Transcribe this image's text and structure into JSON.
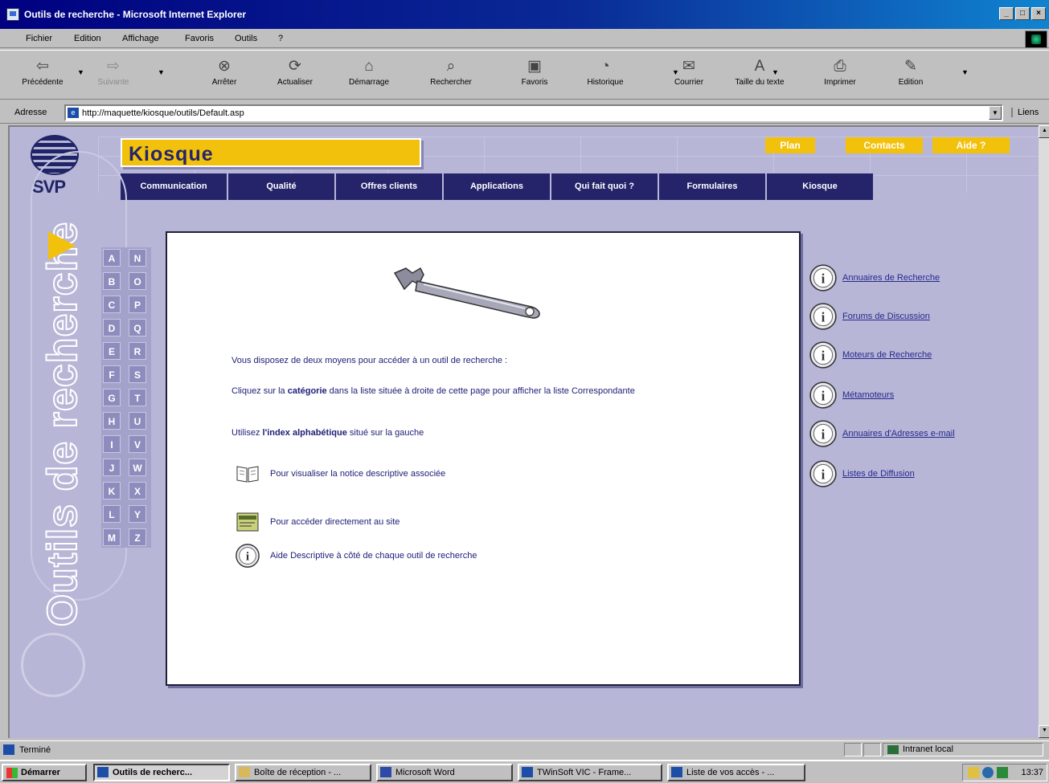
{
  "window": {
    "title": "Outils de recherche - Microsoft Internet Explorer",
    "controls": [
      "_",
      "□",
      "×"
    ]
  },
  "menubar": [
    "Fichier",
    "Edition",
    "Affichage",
    "Favoris",
    "Outils",
    "?"
  ],
  "toolbar": [
    {
      "label": "Précédente",
      "icon": "back-arrow-icon",
      "glyph": "⇦",
      "enabled": true
    },
    {
      "label": "Suivante",
      "icon": "forward-arrow-icon",
      "glyph": "⇨",
      "enabled": false
    },
    {
      "label": "Arrêter",
      "icon": "stop-icon",
      "glyph": "⊗",
      "enabled": true
    },
    {
      "label": "Actualiser",
      "icon": "refresh-icon",
      "glyph": "⟳",
      "enabled": true
    },
    {
      "label": "Démarrage",
      "icon": "home-icon",
      "glyph": "⌂",
      "enabled": true
    },
    {
      "label": "Rechercher",
      "icon": "search-icon",
      "glyph": "⌕",
      "enabled": true
    },
    {
      "label": "Favoris",
      "icon": "favorites-icon",
      "glyph": "▣",
      "enabled": true
    },
    {
      "label": "Historique",
      "icon": "history-icon",
      "glyph": "◔",
      "enabled": true
    },
    {
      "label": "Courrier",
      "icon": "mail-icon",
      "glyph": "✉",
      "enabled": true
    },
    {
      "label": "Taille du texte",
      "icon": "text-size-icon",
      "glyph": "A",
      "enabled": true
    },
    {
      "label": "Imprimer",
      "icon": "print-icon",
      "glyph": "⎙",
      "enabled": true
    },
    {
      "label": "Edition",
      "icon": "edit-icon",
      "glyph": "✎",
      "enabled": true
    }
  ],
  "address": {
    "label": "Adresse",
    "url": "http://maquette/kiosque/outils/Default.asp",
    "links_label": "Liens"
  },
  "page": {
    "logo_text": "SVP",
    "site_title": "Kiosque",
    "util_links": [
      "Plan",
      "Contacts",
      "Aide ?"
    ],
    "nav": [
      "Communication",
      "Qualité",
      "Offres clients",
      "Applications",
      "Qui fait quoi ?",
      "Formulaires",
      "Kiosque"
    ],
    "section_title": "Outils de recherche",
    "alphabet": [
      "A",
      "N",
      "B",
      "O",
      "C",
      "P",
      "D",
      "Q",
      "E",
      "R",
      "F",
      "S",
      "G",
      "T",
      "H",
      "U",
      "I",
      "V",
      "J",
      "W",
      "K",
      "X",
      "L",
      "Y",
      "M",
      "Z"
    ],
    "content": {
      "intro": "Vous disposez de deux moyens pour accéder à un outil de recherche :",
      "line1_pre": "Cliquez sur la ",
      "line1_bold": "catégorie",
      "line1_post": " dans la liste située à droite de cette page pour afficher la liste Correspondante",
      "line2_pre": "Utilisez ",
      "line2_bold": "l'index alphabétique",
      "line2_post": " situé sur la gauche",
      "legend": [
        {
          "icon": "book-icon",
          "text": "Pour visualiser la notice descriptive associée"
        },
        {
          "icon": "site-icon",
          "text": "Pour accéder directement au site"
        },
        {
          "icon": "info-icon",
          "text": "Aide Descriptive à côté de chaque outil de recherche"
        }
      ]
    },
    "categories": [
      "Annuaires de Recherche",
      "Forums de Discussion",
      "Moteurs de Recherche",
      "Métamoteurs",
      "Annuaires d'Adresses e-mail",
      "Listes de Diffusion"
    ]
  },
  "status": {
    "text": "Terminé",
    "zone": "Intranet local"
  },
  "taskbar": {
    "start": "Démarrer",
    "tasks": [
      {
        "label": "Outils de recherc...",
        "active": true
      },
      {
        "label": "Boîte de réception - ...",
        "active": false
      },
      {
        "label": "Microsoft Word",
        "active": false
      },
      {
        "label": "TWinSoft VIC - Frame...",
        "active": false
      },
      {
        "label": "Liste de vos accès - ...",
        "active": false
      }
    ],
    "clock": "13:37"
  },
  "colors": {
    "page_bg": "#b7b6d7",
    "accent_yellow": "#f2c10b",
    "nav_navy": "#25246b"
  }
}
